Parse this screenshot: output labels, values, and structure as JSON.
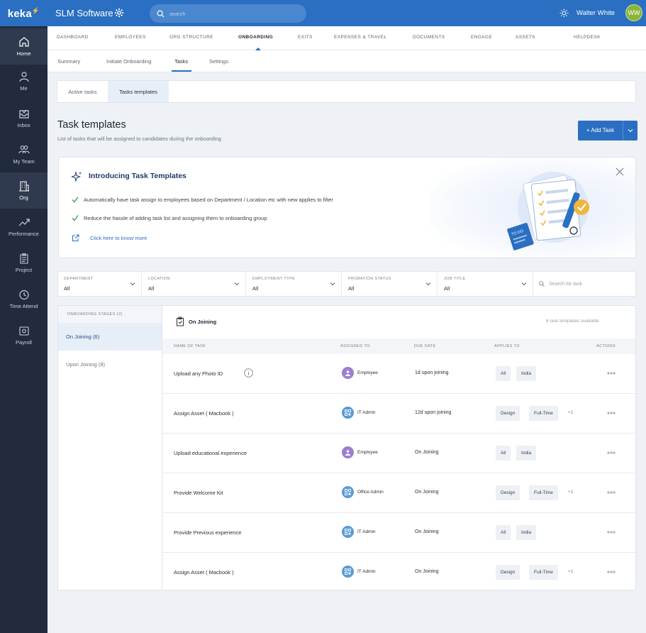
{
  "app": {
    "logo": "keka",
    "org_name": "SLM Software",
    "search_placeholder": "search",
    "user_name": "Walter White",
    "user_initials": "WW"
  },
  "sidebar": {
    "items": [
      {
        "label": "Home",
        "icon": "home-icon",
        "active": true
      },
      {
        "label": "Me",
        "icon": "user-icon"
      },
      {
        "label": "Inbox",
        "icon": "inbox-icon"
      },
      {
        "label": "My Team",
        "icon": "team-icon"
      },
      {
        "label": "Org",
        "icon": "building-icon",
        "active": true
      },
      {
        "label": "Performance",
        "icon": "trend-icon"
      },
      {
        "label": "Project",
        "icon": "clipboard-icon"
      },
      {
        "label": "Time Attend",
        "icon": "clock-icon"
      },
      {
        "label": "Payroll",
        "icon": "money-icon"
      }
    ]
  },
  "main_nav": [
    "DASHBOARD",
    "EMPLOYEES",
    "ORG STRUCTURE",
    "ONBOARDING",
    "EXITS",
    "EXPENSES & TRAVEL",
    "DOCUMENTS",
    "ENGAGE",
    "ASSETS",
    "HELPDESK"
  ],
  "main_nav_active": "ONBOARDING",
  "sub_nav": [
    "Summary",
    "Initiate Onboarding",
    "Tasks",
    "Settings"
  ],
  "sub_nav_active": "Tasks",
  "tabs": [
    "Active tasks",
    "Tasks templates"
  ],
  "tabs_active": "Tasks templates",
  "page": {
    "title": "Task templates",
    "subtitle": "List of tasks that will be assigned to candidates during the onboarding",
    "add_button": "+ Add Task"
  },
  "intro": {
    "title": "Introducing Task Templates",
    "line1": "Automatically have task assign to employees based on Department / Location etc with new applies to filter",
    "line2": "Reduce the hassle of adding task list and assigning them to onboarding group",
    "link": "Click here to know more",
    "illustration_label": "TO DO"
  },
  "filters": [
    {
      "label": "DEPARTMENT",
      "value": "All"
    },
    {
      "label": "LOCATION",
      "value": "All"
    },
    {
      "label": "EMPLOYMENT TYPE",
      "value": "All"
    },
    {
      "label": "PROBATION STATUS",
      "value": "All"
    },
    {
      "label": "JOB TITLE",
      "value": "All"
    }
  ],
  "filter_search_placeholder": "Search for task",
  "stages": {
    "header": "ONBOARDING STAGES (2)",
    "items": [
      {
        "label": "On Joining (6)",
        "active": true
      },
      {
        "label": "Upon Joining (8)"
      }
    ]
  },
  "table": {
    "title": "On Joining",
    "count": "6 task templates available",
    "headers": [
      "NAME OF TASK",
      "ASSIGNED TO",
      "DUE DATE",
      "APPLIES TO",
      "ACTIONS"
    ],
    "rows": [
      {
        "name": "Upload any Photo ID",
        "info": true,
        "assignee": "Employee",
        "assignee_type": "person",
        "due": "1d upon joining",
        "applies": [
          "All",
          "India"
        ],
        "more": ""
      },
      {
        "name": "Assign Asset ( Macbook )",
        "assignee": "IT Admin",
        "assignee_type": "admin",
        "due": "12d upon joining",
        "applies": [
          "Design",
          "Full-Time"
        ],
        "more": "+1"
      },
      {
        "name": "Upload educational experience",
        "assignee": "Employee",
        "assignee_type": "person",
        "due": "On Joining",
        "applies": [
          "All",
          "India"
        ],
        "more": ""
      },
      {
        "name": "Provide Welcome Kit",
        "assignee": "Office Admin",
        "assignee_type": "admin",
        "due": "On Joining",
        "applies": [
          "Design",
          "Full-Time"
        ],
        "more": "+1"
      },
      {
        "name": "Provide Previous experience",
        "assignee": "IT Admin",
        "assignee_type": "admin",
        "due": "On Joining",
        "applies": [
          "All",
          "India"
        ],
        "more": ""
      },
      {
        "name": "Assign Asset ( Macbook )",
        "assignee": "IT Admin",
        "assignee_type": "admin",
        "due": "On Joining",
        "applies": [
          "Design",
          "Full-Time"
        ],
        "more": "+1"
      }
    ]
  },
  "colors": {
    "brand": "#2a6fc1",
    "sidebar": "#222b3d",
    "person_avatar": "#9b7fcf",
    "admin_avatar": "#5a9bd5",
    "success": "#3aaa5c"
  }
}
